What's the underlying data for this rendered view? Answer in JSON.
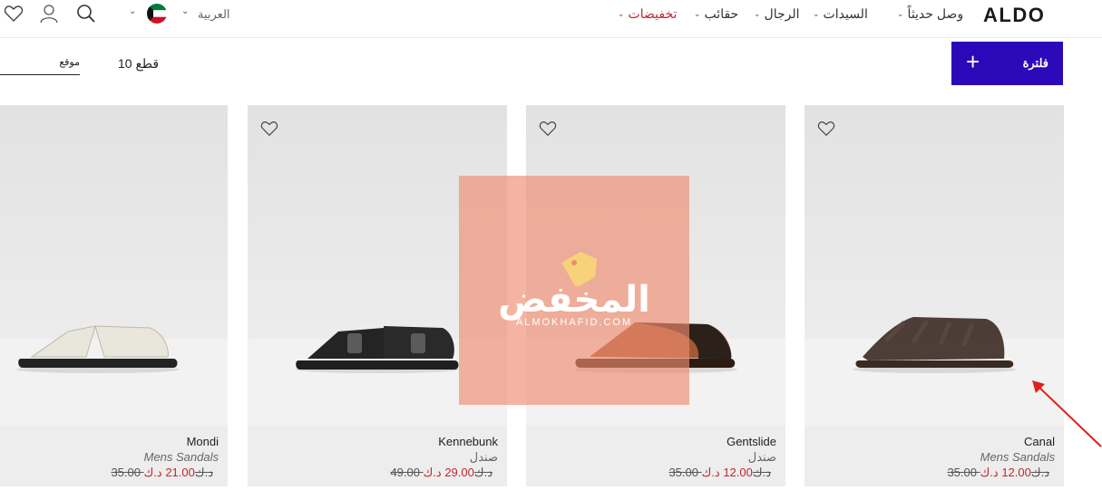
{
  "header": {
    "logo": "ALDO",
    "nav": [
      "وصل حديثاً",
      "السيدات",
      "الرجال",
      "حقائب",
      "تخفيضات"
    ],
    "language": "العربية"
  },
  "toolbar": {
    "filter_label": "فلترة",
    "filter_plus": "+",
    "count": "10 قطع",
    "sort_label": "موقع"
  },
  "products": [
    {
      "name": "Canal",
      "category": "Mens Sandals",
      "old_price": "35.00 د.ك",
      "new_price": "12.00 د.ك"
    },
    {
      "name": "Gentslide",
      "category": "صندل",
      "old_price": "35.00 د.ك",
      "new_price": "12.00 د.ك"
    },
    {
      "name": "Kennebunk",
      "category": "صندل",
      "old_price": "49.00 د.ك",
      "new_price": "29.00 د.ك"
    },
    {
      "name": "Mondi",
      "category": "Mens Sandals",
      "old_price": "35.00 د.ك",
      "new_price": "21.00 د.ك"
    }
  ],
  "watermark": {
    "text": "المخفض",
    "sub": "ALMOKHAFID.COM"
  },
  "colors": {
    "accent": "#2b09b8",
    "sale": "#c1272d",
    "watermark": "#f08c6e"
  },
  "icons": [
    "heart-icon",
    "user-icon",
    "search-icon",
    "kuwait-flag-icon",
    "chevron-down-icon",
    "plus-icon"
  ]
}
